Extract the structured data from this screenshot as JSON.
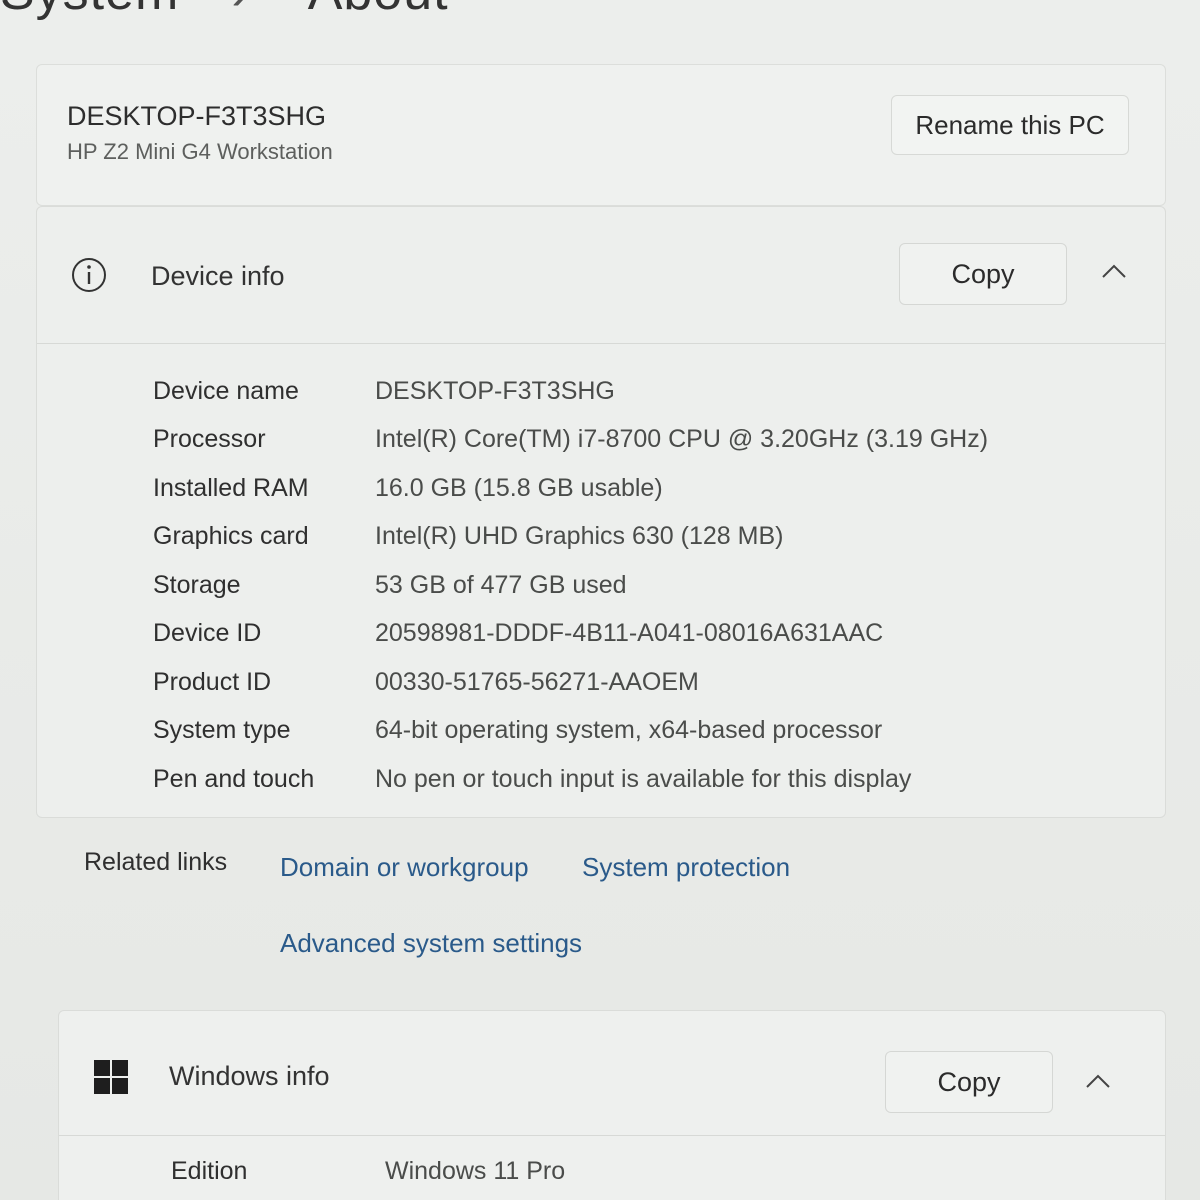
{
  "header": {
    "breadcrumb_root": "System",
    "separator": "›",
    "page_title": "About"
  },
  "pc": {
    "name": "DESKTOP-F3T3SHG",
    "model": "HP Z2 Mini G4 Workstation",
    "rename_label": "Rename this PC"
  },
  "device_info": {
    "icon": "info-icon",
    "title": "Device info",
    "copy_label": "Copy",
    "specs": [
      {
        "label": "Device name",
        "value": "DESKTOP-F3T3SHG"
      },
      {
        "label": "Processor",
        "value": "Intel(R) Core(TM) i7-8700 CPU @ 3.20GHz (3.19 GHz)"
      },
      {
        "label": "Installed RAM",
        "value": "16.0 GB (15.8 GB usable)"
      },
      {
        "label": "Graphics card",
        "value": "Intel(R) UHD Graphics 630 (128 MB)"
      },
      {
        "label": "Storage",
        "value": "53 GB of 477 GB used"
      },
      {
        "label": "Device ID",
        "value": "20598981-DDDF-4B11-A041-08016A631AAC"
      },
      {
        "label": "Product ID",
        "value": "00330-51765-56271-AAOEM"
      },
      {
        "label": "System type",
        "value": "64-bit operating system, x64-based processor"
      },
      {
        "label": "Pen and touch",
        "value": "No pen or touch input is available for this display"
      }
    ]
  },
  "related_links": {
    "label": "Related links",
    "links": [
      "Domain or workgroup",
      "System protection",
      "Advanced system settings"
    ]
  },
  "windows_info": {
    "icon": "windows-logo-icon",
    "title": "Windows info",
    "copy_label": "Copy",
    "specs": [
      {
        "label": "Edition",
        "value": "Windows 11 Pro"
      }
    ]
  },
  "colors": {
    "link": "#2a5a8a",
    "card": "#edefed",
    "text": "#2b2b2b"
  }
}
